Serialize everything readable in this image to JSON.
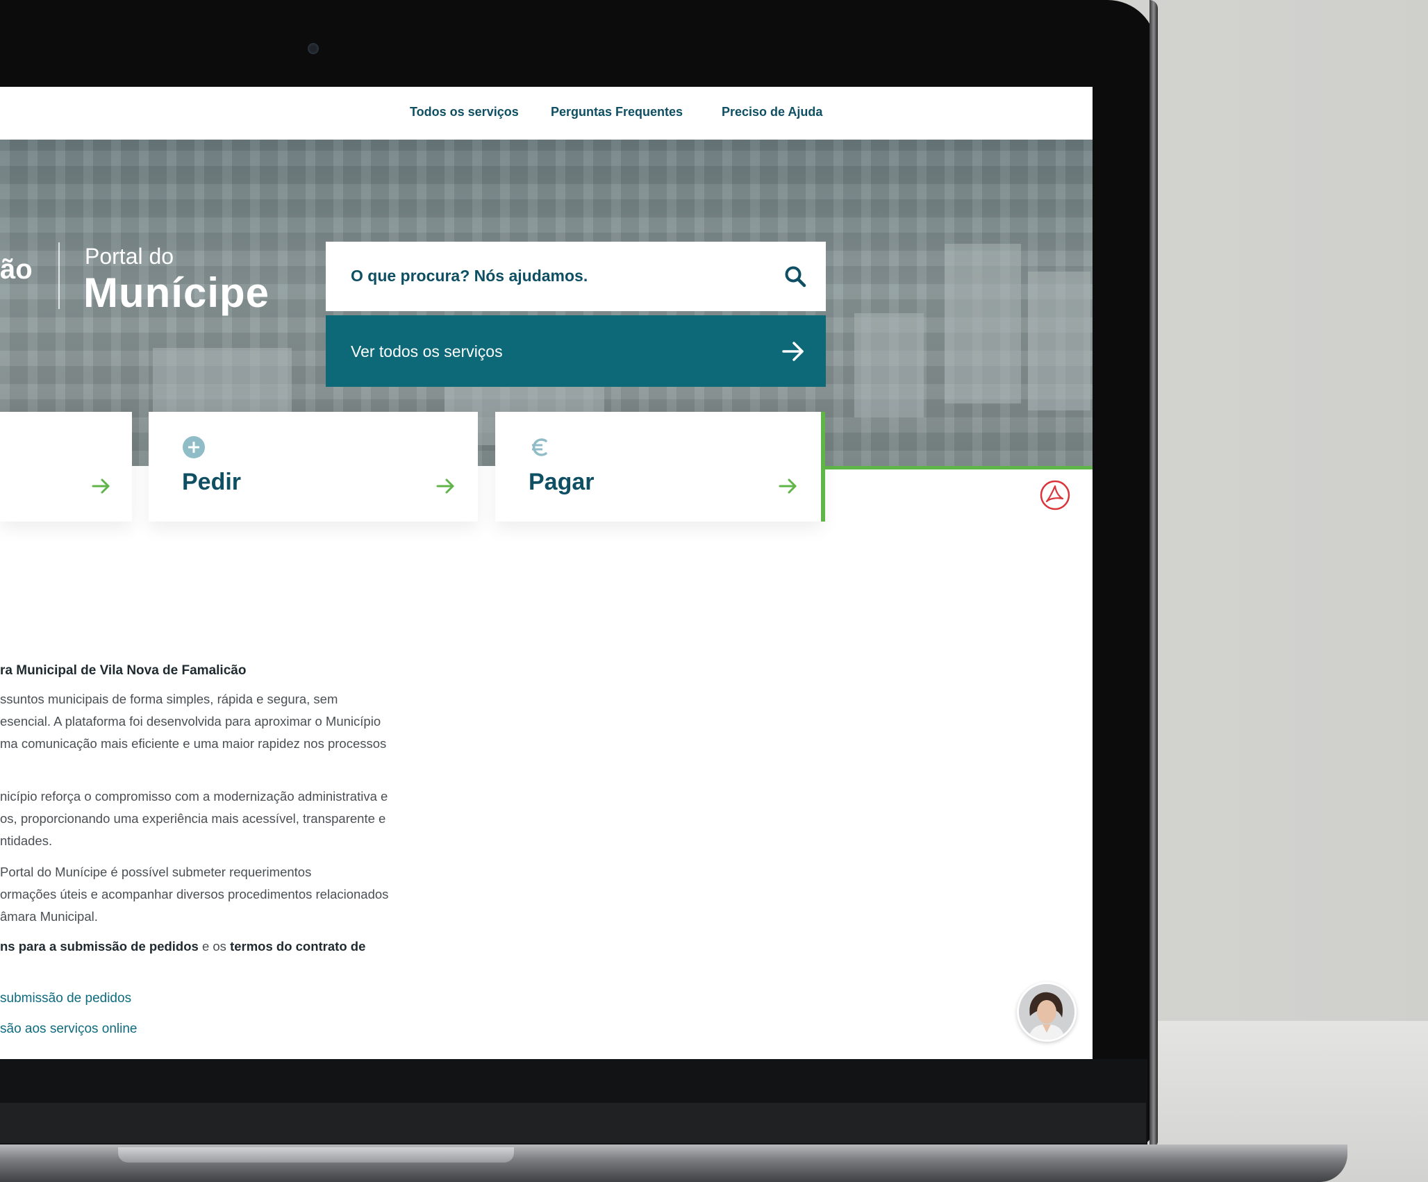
{
  "nav": {
    "links": [
      "Todos os serviços",
      "Perguntas Frequentes",
      "Preciso de Ajuda"
    ]
  },
  "brand": {
    "cut_text": "ão",
    "subtitle": "Portal do",
    "title": "Munícipe"
  },
  "search": {
    "placeholder": "O que procura? Nós ajudamos.",
    "icon": "search-icon"
  },
  "all_services": {
    "label": "Ver todos os serviços",
    "icon": "arrow-right-icon"
  },
  "cards": [
    {
      "title": "Pedir",
      "icon": "plus-circle-icon"
    },
    {
      "title": "Pagar",
      "icon": "euro-icon"
    }
  ],
  "content": {
    "heading": "ra Municipal de Vila Nova de Famalicão",
    "paragraph_1": [
      "ssuntos municipais de forma simples, rápida e segura, sem",
      "esencial. A plataforma foi desenvolvida para aproximar o Município",
      "ma comunicação mais eficiente e uma maior rapidez nos processos"
    ],
    "paragraph_2": [
      "nicípio reforça o compromisso com a modernização administrativa e",
      "os, proporcionando uma experiência mais acessível, transparente e",
      "ntidades."
    ],
    "paragraph_3": [
      " Portal do Munícipe é possível submeter requerimentos",
      "ormações úteis e acompanhar diversos procedimentos relacionados",
      "âmara Municipal."
    ],
    "terms_line": {
      "bold_1": "ns para a submissão de pedidos",
      "middle": " e os ",
      "bold_2": "termos do contrato de"
    },
    "links": [
      "submissão de pedidos",
      "são aos serviços online"
    ]
  },
  "colors": {
    "primary": "#0e4f63",
    "teal_button": "#0d6878",
    "accent_green": "#5fb548",
    "pdf_red": "#d9343a"
  }
}
